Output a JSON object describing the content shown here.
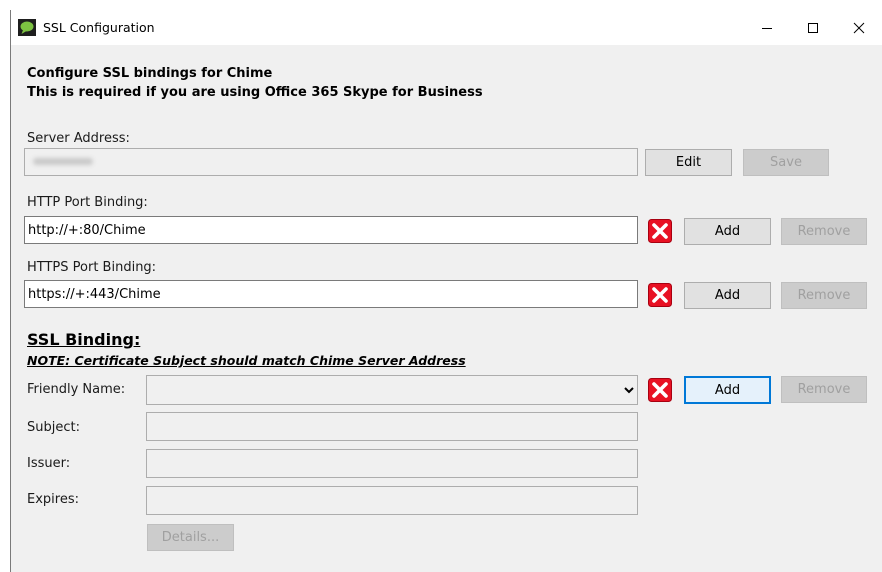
{
  "window": {
    "title": "SSL Configuration",
    "controls": {
      "minimize": "—",
      "maximize": "☐",
      "close": "✕"
    }
  },
  "intro": {
    "line1": "Configure SSL bindings for Chime",
    "line2": "This is required if you are using Office 365 Skype for Business"
  },
  "server": {
    "label": "Server Address:",
    "value_redacted": true,
    "edit_label": "Edit",
    "save_label": "Save"
  },
  "http": {
    "label": "HTTP Port Binding:",
    "value": "http://+:80/Chime",
    "add_label": "Add",
    "remove_label": "Remove"
  },
  "https": {
    "label": "HTTPS Port Binding:",
    "value": "https://+:443/Chime",
    "add_label": "Add",
    "remove_label": "Remove"
  },
  "ssl": {
    "heading": "SSL Binding:",
    "note": "NOTE: Certificate Subject should match Chime Server Address",
    "friendly_name_label": "Friendly Name:",
    "friendly_name_value": "",
    "subject_label": "Subject:",
    "subject_value": "",
    "issuer_label": "Issuer:",
    "issuer_value": "",
    "expires_label": "Expires:",
    "expires_value": "",
    "add_label": "Add",
    "remove_label": "Remove",
    "details_label": "Details..."
  },
  "colors": {
    "window_bg": "#f0f0f0",
    "accent_focus": "#0078d7",
    "delete_icon_red": "#e81123",
    "app_icon_green": "#7dc242"
  },
  "icons": [
    "chat-bubble-icon",
    "delete-x-icon"
  ]
}
